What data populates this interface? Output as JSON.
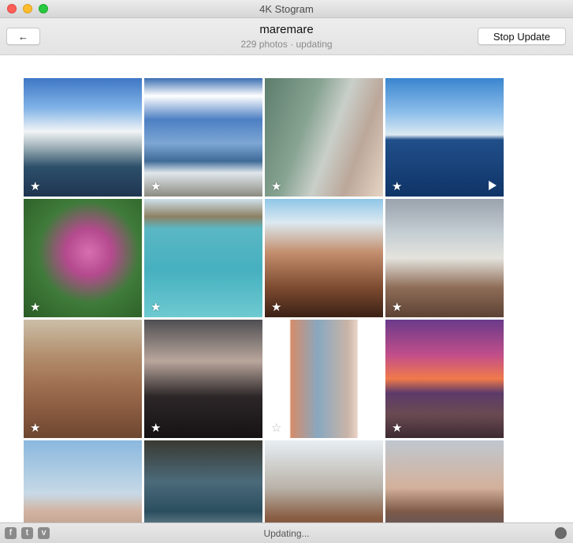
{
  "window": {
    "title": "4K Stogram"
  },
  "toolbar": {
    "back_label": "←",
    "account_name": "maremare",
    "account_status": "229 photos · updating",
    "stop_label": "Stop Update"
  },
  "photos": [
    {
      "desc": "harbor with boats",
      "starred": true,
      "video": false
    },
    {
      "desc": "clouds over sea",
      "starred": true,
      "video": false
    },
    {
      "desc": "beach umbrellas",
      "starred": true,
      "video": false
    },
    {
      "desc": "open sea",
      "starred": true,
      "video": true
    },
    {
      "desc": "pink oleander",
      "starred": true,
      "video": false
    },
    {
      "desc": "woman in water",
      "starred": true,
      "video": false
    },
    {
      "desc": "three women selfie",
      "starred": true,
      "video": false
    },
    {
      "desc": "boat deck",
      "starred": true,
      "video": false
    },
    {
      "desc": "bracelets",
      "starred": true,
      "video": false
    },
    {
      "desc": "woman portrait",
      "starred": true,
      "video": false
    },
    {
      "desc": "legs on beach",
      "starred": false,
      "video": false
    },
    {
      "desc": "sunset",
      "starred": true,
      "video": false
    },
    {
      "desc": "two men selfie",
      "starred": false,
      "video": false
    },
    {
      "desc": "rocky coast",
      "starred": false,
      "video": false
    },
    {
      "desc": "people with palm",
      "starred": false,
      "video": false
    },
    {
      "desc": "two men sunglasses",
      "starred": false,
      "video": false
    }
  ],
  "statusbar": {
    "text": "Updating...",
    "icons": [
      "facebook-icon",
      "twitter-icon",
      "vimeo-icon",
      "globe-icon"
    ]
  }
}
